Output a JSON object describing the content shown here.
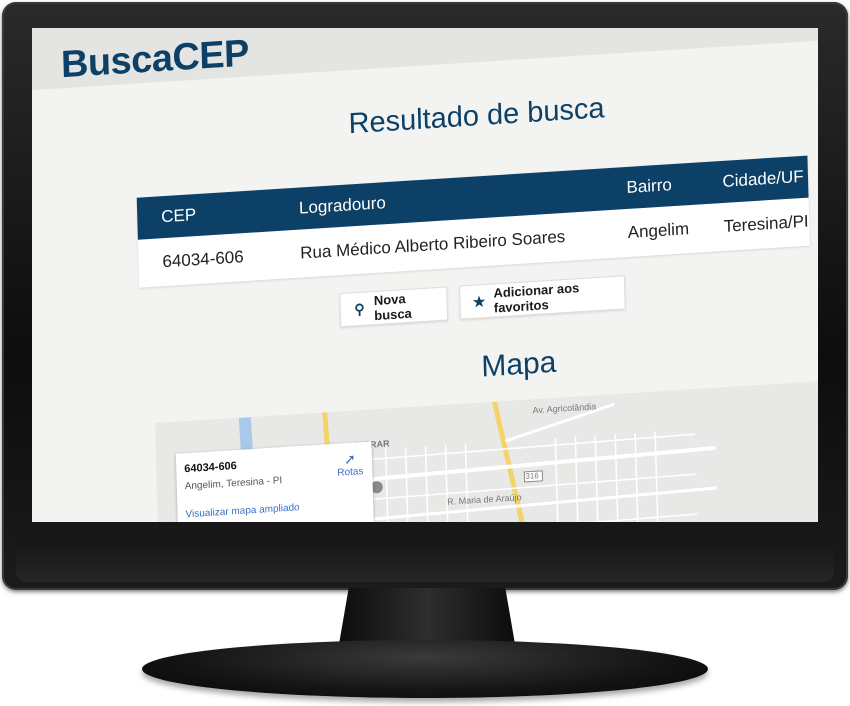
{
  "app": {
    "logo": "BuscaCEP"
  },
  "result": {
    "title": "Resultado de busca",
    "headers": {
      "cep": "CEP",
      "logradouro": "Logradouro",
      "bairro": "Bairro",
      "cidade": "Cidade/UF"
    },
    "row": {
      "cep": "64034-606",
      "logradouro": "Rua Médico Alberto Ribeiro Soares",
      "bairro": "Angelim",
      "cidade": "Teresina/PI"
    }
  },
  "actions": {
    "new_search": "Nova busca",
    "add_favorites": "Adicionar aos favoritos"
  },
  "map": {
    "title": "Mapa",
    "card": {
      "cep": "64034-606",
      "address": "Angelim, Teresina - PI",
      "link": "Visualizar mapa ampliado",
      "routes": "Rotas"
    },
    "labels": {
      "area": "MORAR",
      "street": "R. Maria de Araújo",
      "avenue": "Av. Agricolândia",
      "route": "316"
    }
  },
  "colors": {
    "brand": "#0d4066",
    "link": "#3a6fc3",
    "background": "#f3f3f1"
  },
  "icons": {
    "search": "search-icon",
    "star": "star-icon",
    "routes": "directions-icon"
  }
}
